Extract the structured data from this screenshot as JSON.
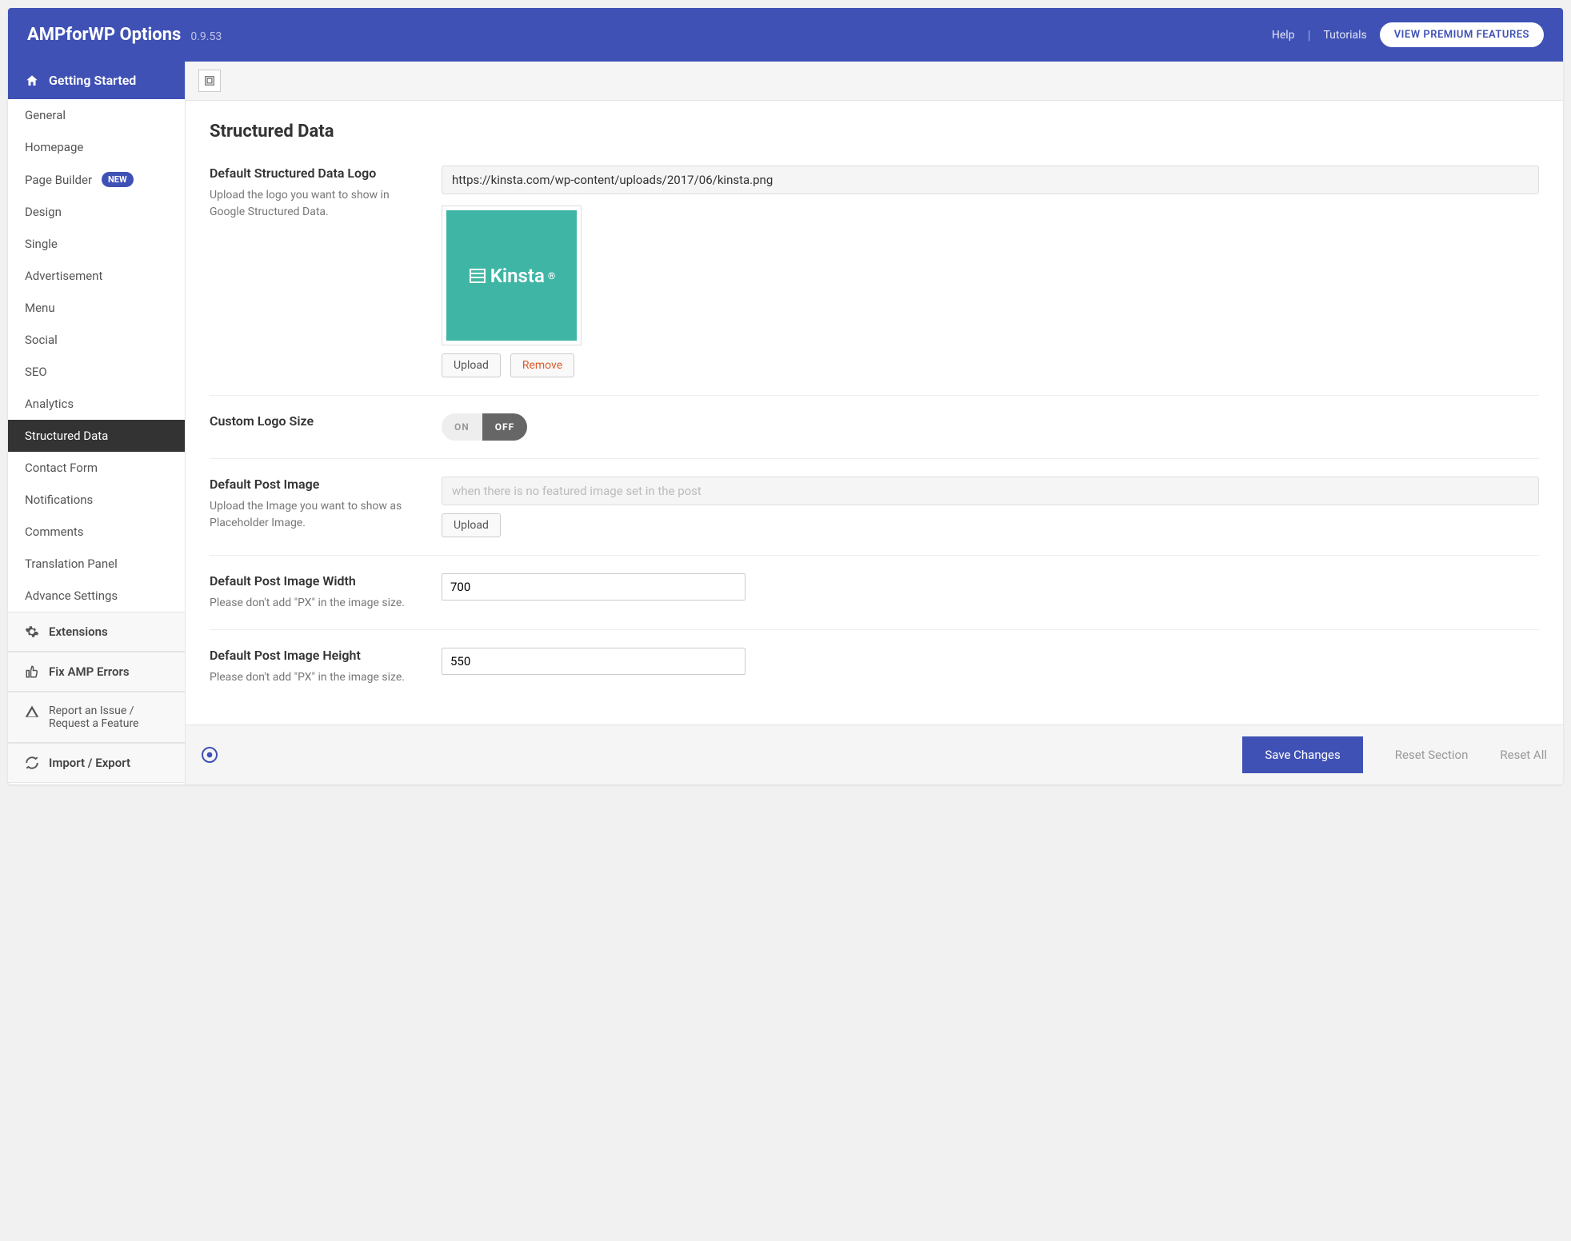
{
  "header": {
    "title": "AMPforWP Options",
    "version": "0.9.53",
    "help": "Help",
    "tutorials": "Tutorials",
    "premium": "VIEW PREMIUM FEATURES"
  },
  "sidebar": {
    "top": "Getting Started",
    "items": [
      {
        "label": "General"
      },
      {
        "label": "Homepage"
      },
      {
        "label": "Page Builder",
        "badge": "NEW"
      },
      {
        "label": "Design"
      },
      {
        "label": "Single"
      },
      {
        "label": "Advertisement"
      },
      {
        "label": "Menu"
      },
      {
        "label": "Social"
      },
      {
        "label": "SEO"
      },
      {
        "label": "Analytics"
      },
      {
        "label": "Structured Data",
        "active": true
      },
      {
        "label": "Contact Form"
      },
      {
        "label": "Notifications"
      },
      {
        "label": "Comments"
      },
      {
        "label": "Translation Panel"
      },
      {
        "label": "Advance Settings"
      }
    ],
    "extensions": "Extensions",
    "fix": "Fix AMP Errors",
    "report1": "Report an Issue /",
    "report2": "Request a Feature",
    "import": "Import / Export"
  },
  "page": {
    "title": "Structured Data",
    "logo": {
      "label": "Default Structured Data Logo",
      "desc": "Upload the logo you want to show in Google Structured Data.",
      "url": "https://kinsta.com/wp-content/uploads/2017/06/kinsta.png",
      "brand": "Kinsta",
      "upload": "Upload",
      "remove": "Remove"
    },
    "size": {
      "label": "Custom Logo Size",
      "on": "ON",
      "off": "OFF"
    },
    "postimg": {
      "label": "Default Post Image",
      "desc": "Upload the Image you want to show as Placeholder Image.",
      "placeholder": "when there is no featured image set in the post",
      "upload": "Upload"
    },
    "width": {
      "label": "Default Post Image Width",
      "desc": "Please don't add \"PX\" in the image size.",
      "value": "700"
    },
    "height": {
      "label": "Default Post Image Height",
      "desc": "Please don't add \"PX\" in the image size.",
      "value": "550"
    }
  },
  "footer": {
    "save": "Save Changes",
    "reset_section": "Reset Section",
    "reset_all": "Reset All"
  }
}
